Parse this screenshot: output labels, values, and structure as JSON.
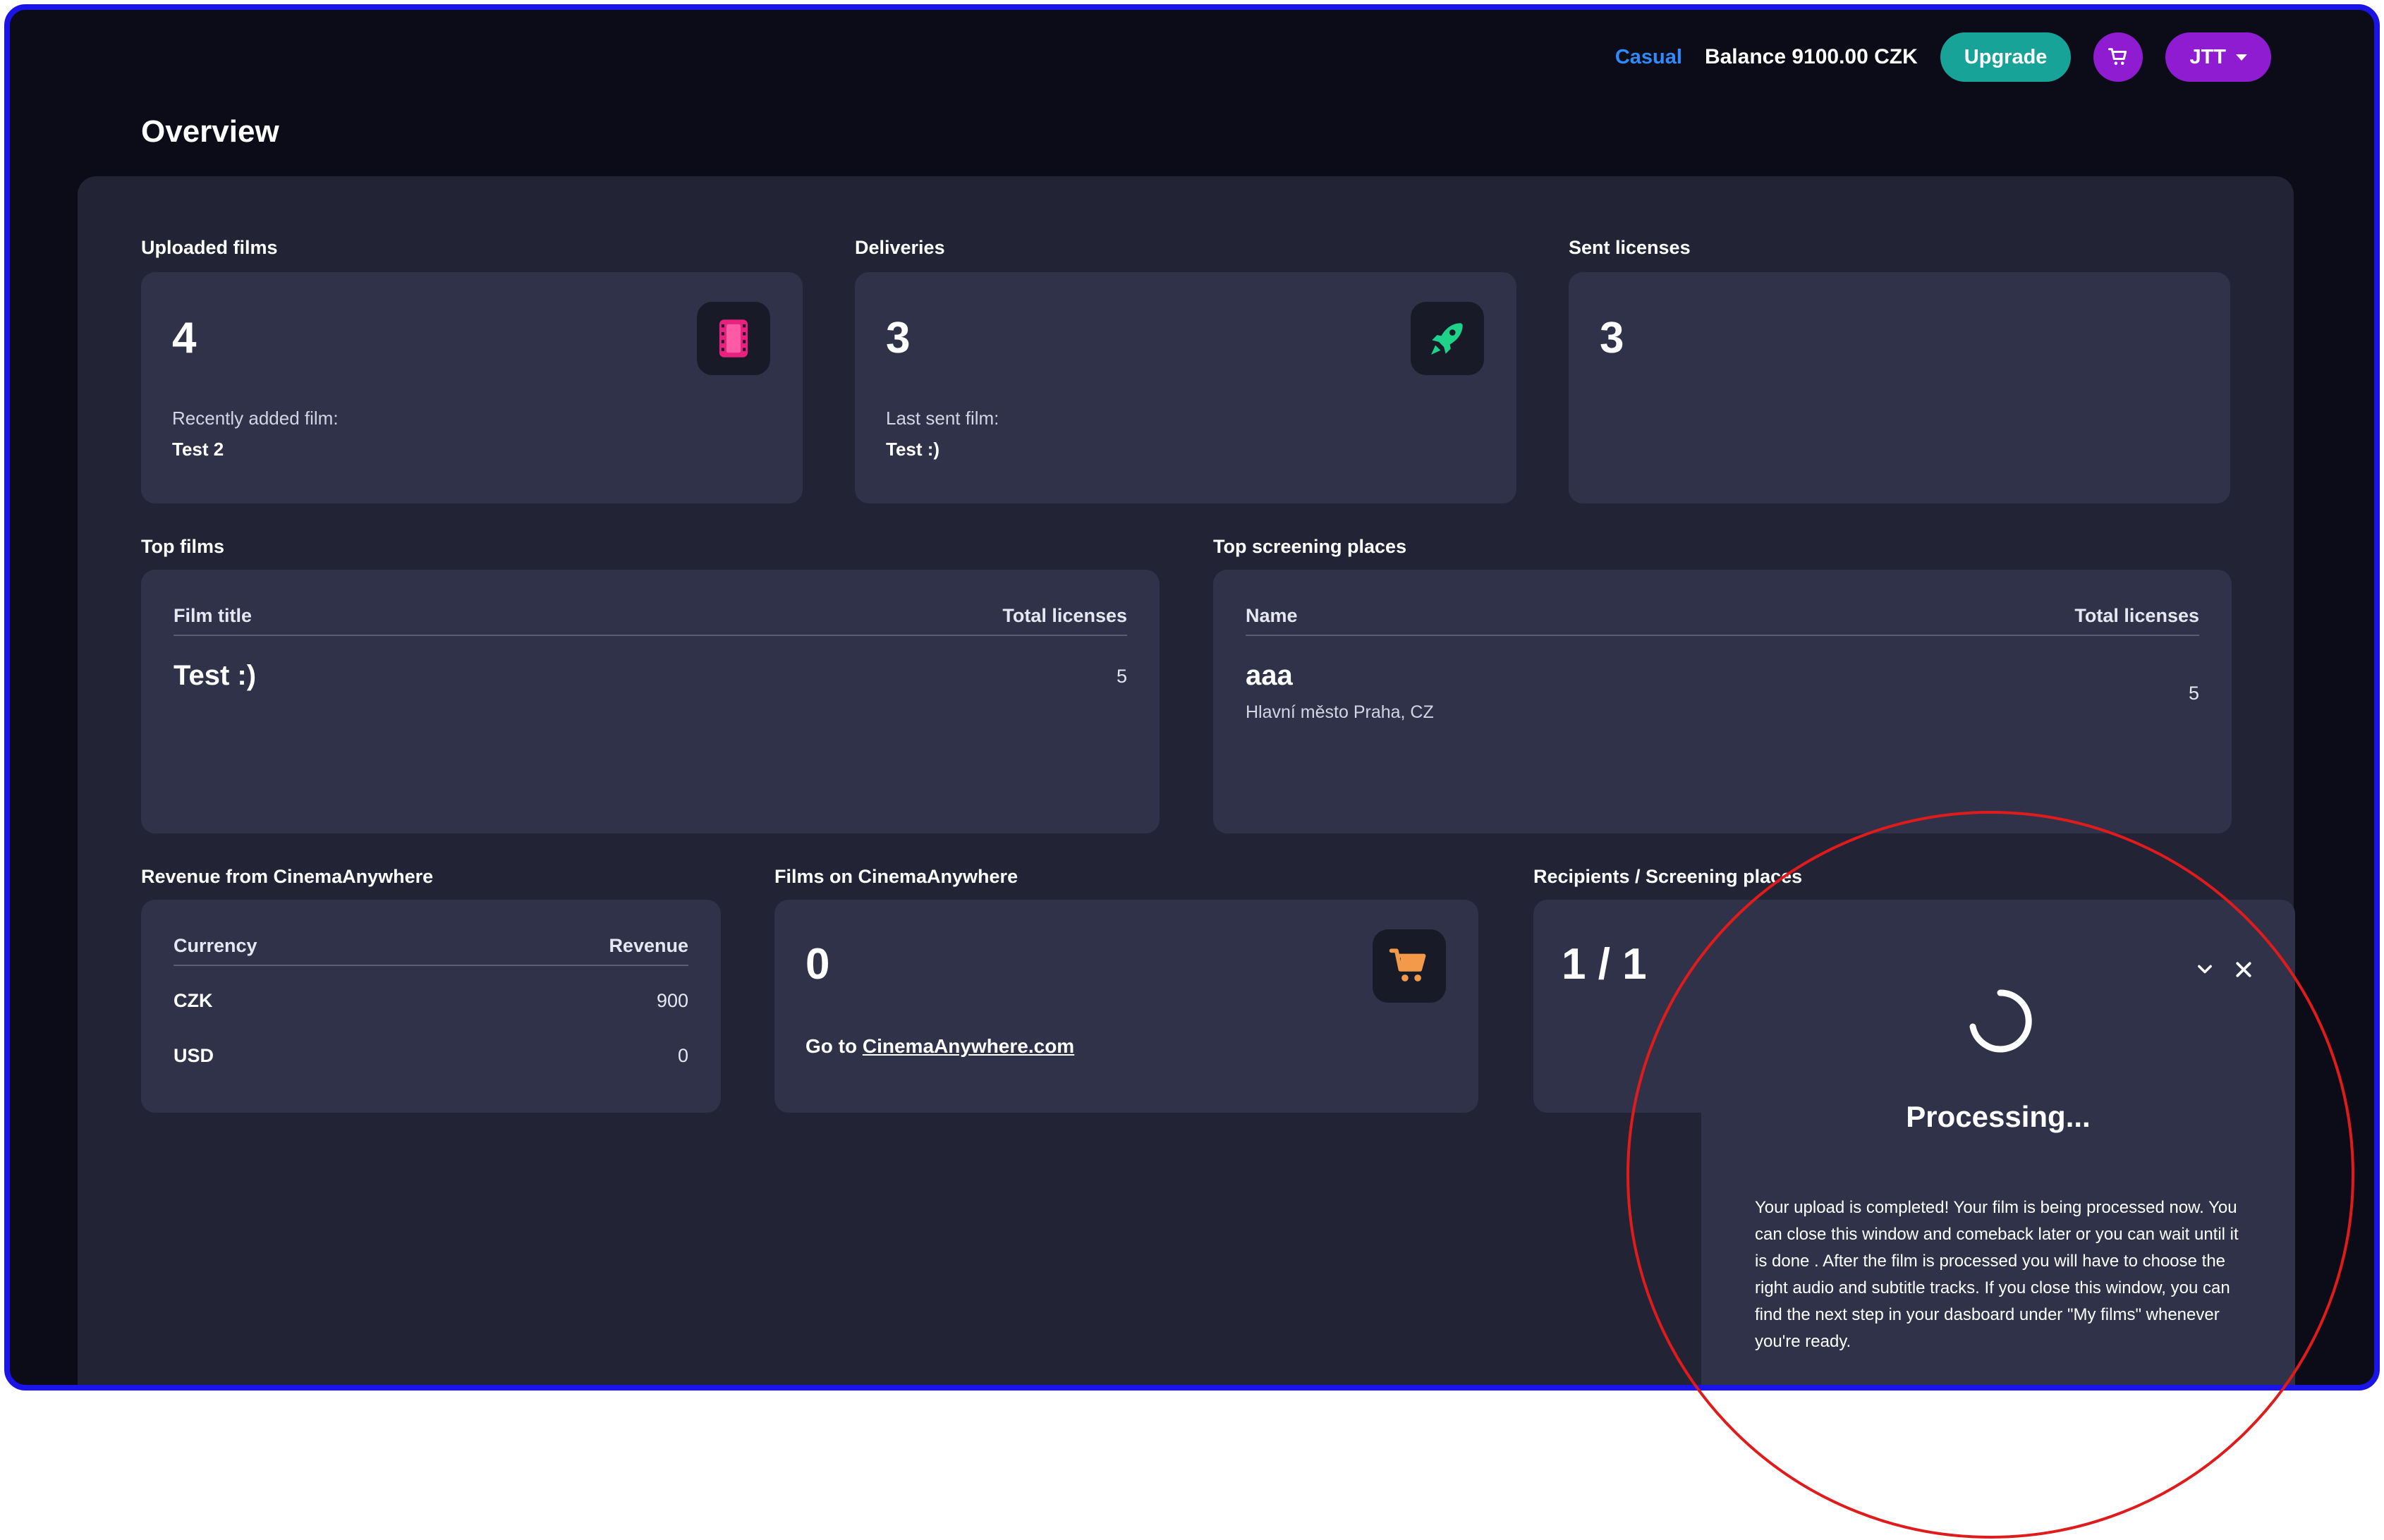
{
  "topbar": {
    "plan": "Casual",
    "balance": "Balance 9100.00 CZK",
    "upgrade_label": "Upgrade",
    "user_label": "JTT"
  },
  "page": {
    "title": "Overview"
  },
  "uploaded_films": {
    "label": "Uploaded films",
    "count": "4",
    "recent_label": "Recently added film:",
    "recent_value": "Test 2"
  },
  "deliveries": {
    "label": "Deliveries",
    "count": "3",
    "last_label": "Last sent film:",
    "last_value": "Test :)"
  },
  "sent_licenses": {
    "label": "Sent licenses",
    "count": "3"
  },
  "top_films": {
    "label": "Top films",
    "col_title": "Film title",
    "col_total": "Total licenses",
    "rows": [
      {
        "title": "Test :)",
        "total": "5"
      }
    ]
  },
  "top_places": {
    "label": "Top screening places",
    "col_name": "Name",
    "col_total": "Total licenses",
    "rows": [
      {
        "name": "aaa",
        "location": "Hlavní město Praha, CZ",
        "total": "5"
      }
    ]
  },
  "revenue": {
    "label": "Revenue from CinemaAnywhere",
    "col_currency": "Currency",
    "col_revenue": "Revenue",
    "rows": [
      {
        "currency": "CZK",
        "revenue": "900"
      },
      {
        "currency": "USD",
        "revenue": "0"
      }
    ]
  },
  "films_ca": {
    "label": "Films on CinemaAnywhere",
    "count": "0",
    "goto_prefix": "Go to",
    "goto_link": "CinemaAnywhere.com"
  },
  "recipients": {
    "label": "Recipients / Screening places",
    "value": "1 / 1"
  },
  "popup": {
    "title": "Processing...",
    "message": "Your upload is completed! Your film is being processed now. You can close this window and comeback later or you can wait until it is done . After the film is processed you will have to choose the right audio and subtitle tracks. If you close this window, you can find the next step in your dasboard under \"My films\" whenever you're ready."
  },
  "colors": {
    "frame_border": "#1a14e6",
    "background": "#0b0c18",
    "panel": "#222436",
    "card": "#303249",
    "plan_accent": "#2d8bff",
    "upgrade": "#18a399",
    "purple": "#8f1cd1",
    "film_icon": "#e8207e",
    "rocket_icon": "#1fd28a",
    "cart_icon": "#f39a4a",
    "annotation": "#e01b1b"
  },
  "icons": [
    "shopping-cart-icon",
    "chevron-down-icon",
    "film-strip-icon",
    "rocket-icon",
    "cart-icon",
    "collapse-chevron-icon",
    "close-icon",
    "spinner-icon"
  ]
}
